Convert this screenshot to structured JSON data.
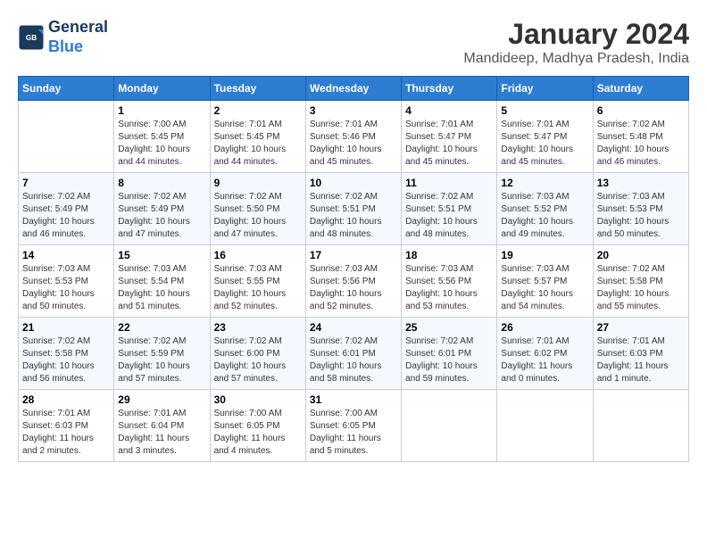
{
  "header": {
    "logo_line1": "General",
    "logo_line2": "Blue",
    "month": "January 2024",
    "location": "Mandideep, Madhya Pradesh, India"
  },
  "weekdays": [
    "Sunday",
    "Monday",
    "Tuesday",
    "Wednesday",
    "Thursday",
    "Friday",
    "Saturday"
  ],
  "weeks": [
    [
      {
        "day": "",
        "info": ""
      },
      {
        "day": "1",
        "info": "Sunrise: 7:00 AM\nSunset: 5:45 PM\nDaylight: 10 hours\nand 44 minutes."
      },
      {
        "day": "2",
        "info": "Sunrise: 7:01 AM\nSunset: 5:45 PM\nDaylight: 10 hours\nand 44 minutes."
      },
      {
        "day": "3",
        "info": "Sunrise: 7:01 AM\nSunset: 5:46 PM\nDaylight: 10 hours\nand 45 minutes."
      },
      {
        "day": "4",
        "info": "Sunrise: 7:01 AM\nSunset: 5:47 PM\nDaylight: 10 hours\nand 45 minutes."
      },
      {
        "day": "5",
        "info": "Sunrise: 7:01 AM\nSunset: 5:47 PM\nDaylight: 10 hours\nand 45 minutes."
      },
      {
        "day": "6",
        "info": "Sunrise: 7:02 AM\nSunset: 5:48 PM\nDaylight: 10 hours\nand 46 minutes."
      }
    ],
    [
      {
        "day": "7",
        "info": "Sunrise: 7:02 AM\nSunset: 5:49 PM\nDaylight: 10 hours\nand 46 minutes."
      },
      {
        "day": "8",
        "info": "Sunrise: 7:02 AM\nSunset: 5:49 PM\nDaylight: 10 hours\nand 47 minutes."
      },
      {
        "day": "9",
        "info": "Sunrise: 7:02 AM\nSunset: 5:50 PM\nDaylight: 10 hours\nand 47 minutes."
      },
      {
        "day": "10",
        "info": "Sunrise: 7:02 AM\nSunset: 5:51 PM\nDaylight: 10 hours\nand 48 minutes."
      },
      {
        "day": "11",
        "info": "Sunrise: 7:02 AM\nSunset: 5:51 PM\nDaylight: 10 hours\nand 48 minutes."
      },
      {
        "day": "12",
        "info": "Sunrise: 7:03 AM\nSunset: 5:52 PM\nDaylight: 10 hours\nand 49 minutes."
      },
      {
        "day": "13",
        "info": "Sunrise: 7:03 AM\nSunset: 5:53 PM\nDaylight: 10 hours\nand 50 minutes."
      }
    ],
    [
      {
        "day": "14",
        "info": "Sunrise: 7:03 AM\nSunset: 5:53 PM\nDaylight: 10 hours\nand 50 minutes."
      },
      {
        "day": "15",
        "info": "Sunrise: 7:03 AM\nSunset: 5:54 PM\nDaylight: 10 hours\nand 51 minutes."
      },
      {
        "day": "16",
        "info": "Sunrise: 7:03 AM\nSunset: 5:55 PM\nDaylight: 10 hours\nand 52 minutes."
      },
      {
        "day": "17",
        "info": "Sunrise: 7:03 AM\nSunset: 5:56 PM\nDaylight: 10 hours\nand 52 minutes."
      },
      {
        "day": "18",
        "info": "Sunrise: 7:03 AM\nSunset: 5:56 PM\nDaylight: 10 hours\nand 53 minutes."
      },
      {
        "day": "19",
        "info": "Sunrise: 7:03 AM\nSunset: 5:57 PM\nDaylight: 10 hours\nand 54 minutes."
      },
      {
        "day": "20",
        "info": "Sunrise: 7:02 AM\nSunset: 5:58 PM\nDaylight: 10 hours\nand 55 minutes."
      }
    ],
    [
      {
        "day": "21",
        "info": "Sunrise: 7:02 AM\nSunset: 5:58 PM\nDaylight: 10 hours\nand 56 minutes."
      },
      {
        "day": "22",
        "info": "Sunrise: 7:02 AM\nSunset: 5:59 PM\nDaylight: 10 hours\nand 57 minutes."
      },
      {
        "day": "23",
        "info": "Sunrise: 7:02 AM\nSunset: 6:00 PM\nDaylight: 10 hours\nand 57 minutes."
      },
      {
        "day": "24",
        "info": "Sunrise: 7:02 AM\nSunset: 6:01 PM\nDaylight: 10 hours\nand 58 minutes."
      },
      {
        "day": "25",
        "info": "Sunrise: 7:02 AM\nSunset: 6:01 PM\nDaylight: 10 hours\nand 59 minutes."
      },
      {
        "day": "26",
        "info": "Sunrise: 7:01 AM\nSunset: 6:02 PM\nDaylight: 11 hours\nand 0 minutes."
      },
      {
        "day": "27",
        "info": "Sunrise: 7:01 AM\nSunset: 6:03 PM\nDaylight: 11 hours\nand 1 minute."
      }
    ],
    [
      {
        "day": "28",
        "info": "Sunrise: 7:01 AM\nSunset: 6:03 PM\nDaylight: 11 hours\nand 2 minutes."
      },
      {
        "day": "29",
        "info": "Sunrise: 7:01 AM\nSunset: 6:04 PM\nDaylight: 11 hours\nand 3 minutes."
      },
      {
        "day": "30",
        "info": "Sunrise: 7:00 AM\nSunset: 6:05 PM\nDaylight: 11 hours\nand 4 minutes."
      },
      {
        "day": "31",
        "info": "Sunrise: 7:00 AM\nSunset: 6:05 PM\nDaylight: 11 hours\nand 5 minutes."
      },
      {
        "day": "",
        "info": ""
      },
      {
        "day": "",
        "info": ""
      },
      {
        "day": "",
        "info": ""
      }
    ]
  ]
}
